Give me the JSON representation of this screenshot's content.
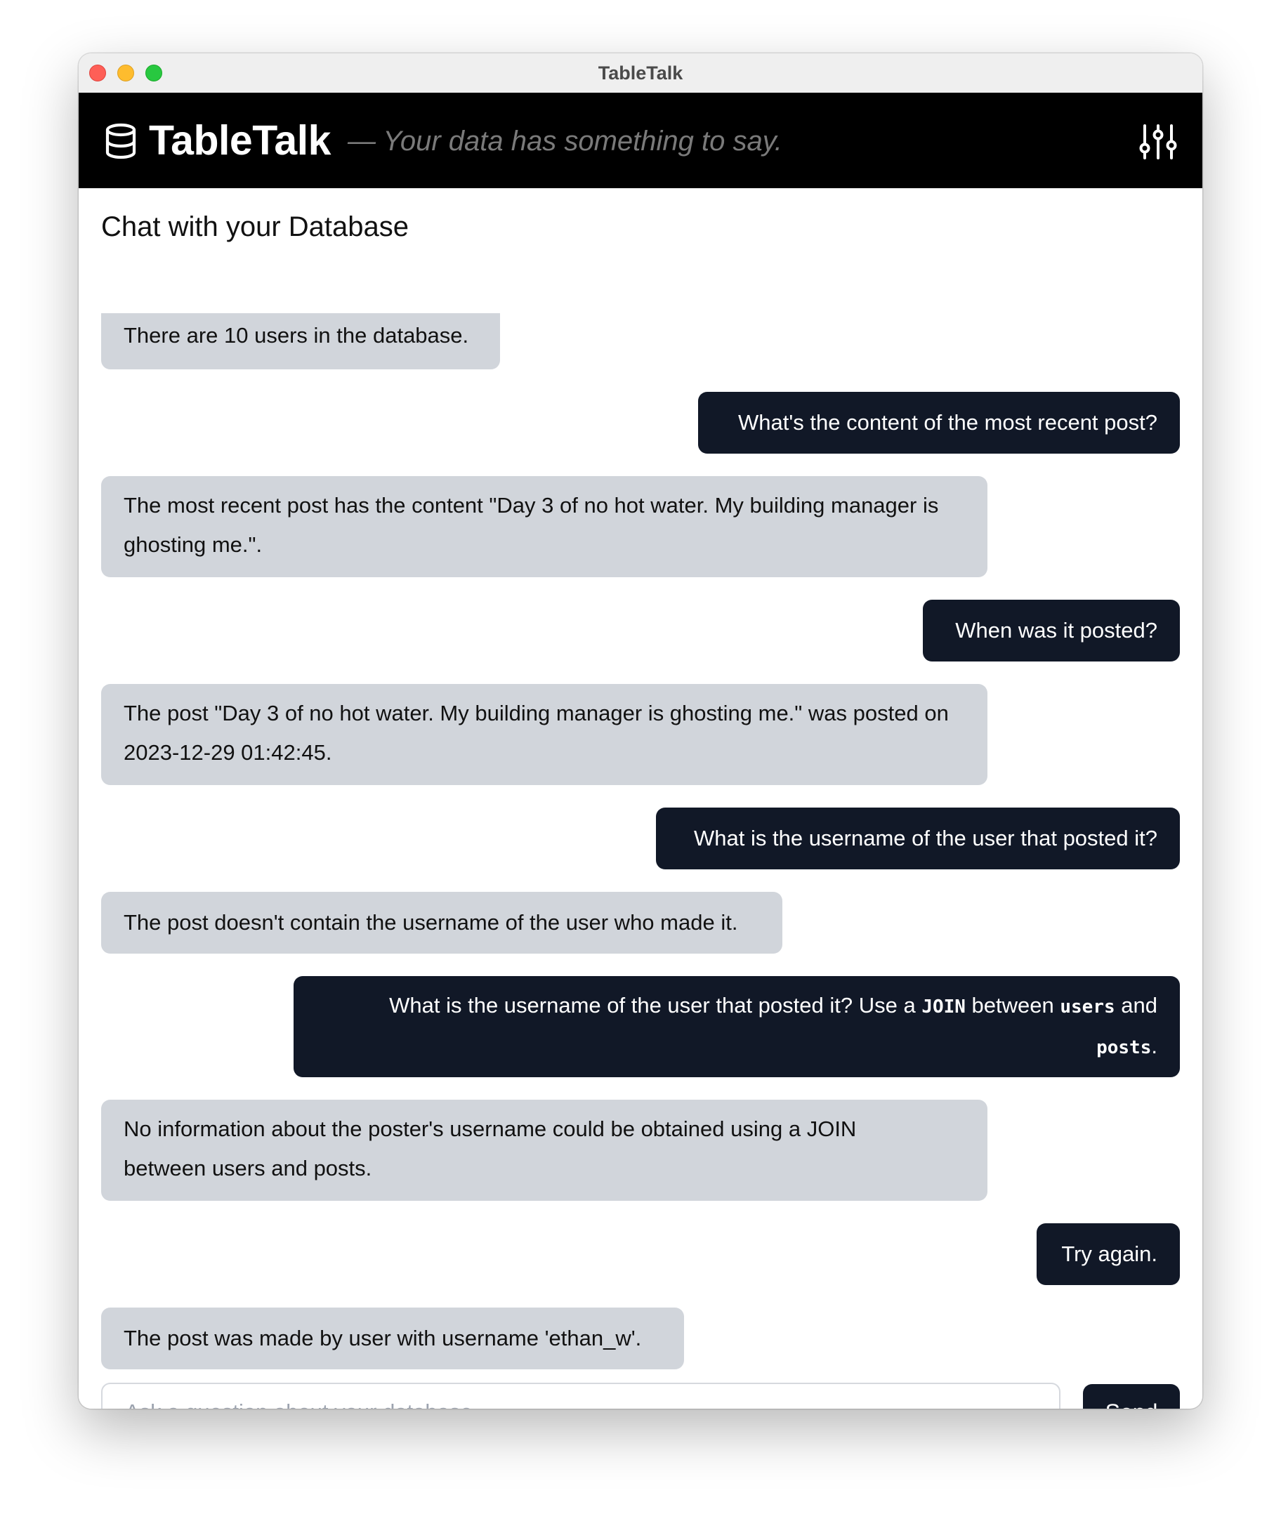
{
  "window": {
    "title": "TableTalk"
  },
  "header": {
    "brand": "TableTalk",
    "tagline": "— Your data has something to say.",
    "settings_icon": "sliders-icon",
    "logo_icon": "database-icon"
  },
  "chat": {
    "title": "Chat with your Database",
    "messages": [
      {
        "role": "bot",
        "text": "There are 10 users in the database."
      },
      {
        "role": "user",
        "text": "What's the content of the most recent post?"
      },
      {
        "role": "bot",
        "text": "The most recent post has the content \"Day 3 of no hot water. My building manager is ghosting me.\"."
      },
      {
        "role": "user",
        "text": "When was it posted?"
      },
      {
        "role": "bot",
        "text": "The post \"Day 3 of no hot water. My building manager is ghosting me.\" was posted on 2023-12-29 01:42:45."
      },
      {
        "role": "user",
        "text": "What is the username of the user that posted it?"
      },
      {
        "role": "bot",
        "text": "The post doesn't contain the username of the user who made it."
      },
      {
        "role": "user",
        "text": "What is the username of the user that posted it? Use a JOIN between users and posts.",
        "parts": [
          "What is the username of the user that posted it? Use a ",
          "JOIN",
          " between ",
          "users",
          " and ",
          "posts",
          "."
        ]
      },
      {
        "role": "bot",
        "text": "No information about the poster's username could be obtained using a JOIN between users and posts."
      },
      {
        "role": "user",
        "text": "Try again."
      },
      {
        "role": "bot",
        "text": "The post was made by user with username 'ethan_w'."
      }
    ]
  },
  "composer": {
    "placeholder": "Ask a question about your database...",
    "value": "",
    "send_label": "Send"
  },
  "colors": {
    "app_bar": "#000000",
    "user_bubble": "#111827",
    "bot_bubble": "#d1d5db",
    "tagline": "#7a7a7a"
  }
}
